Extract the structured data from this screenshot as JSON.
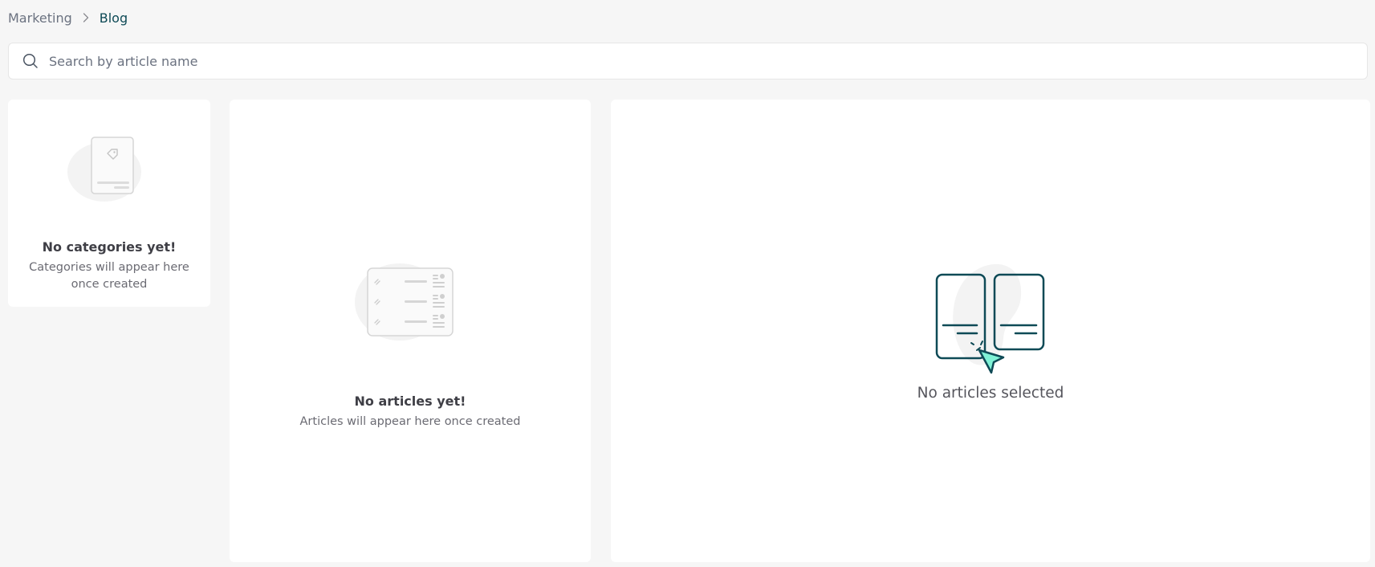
{
  "breadcrumb": {
    "parent": "Marketing",
    "current": "Blog"
  },
  "search": {
    "placeholder": "Search by article name",
    "value": ""
  },
  "categories_panel": {
    "title": "No categories yet!",
    "description": "Categories will appear here once created",
    "illustration": "tag-card-icon"
  },
  "articles_panel": {
    "title": "No articles yet!",
    "description": "Articles will appear here once created",
    "illustration": "article-list-icon"
  },
  "detail_panel": {
    "text": "No articles selected",
    "illustration": "select-article-icon"
  },
  "colors": {
    "background": "#f6f6f6",
    "panel": "#ffffff",
    "accent_dark": "#0e4a56",
    "accent_mint": "#7ff2d6",
    "muted_text": "#6b7280"
  }
}
